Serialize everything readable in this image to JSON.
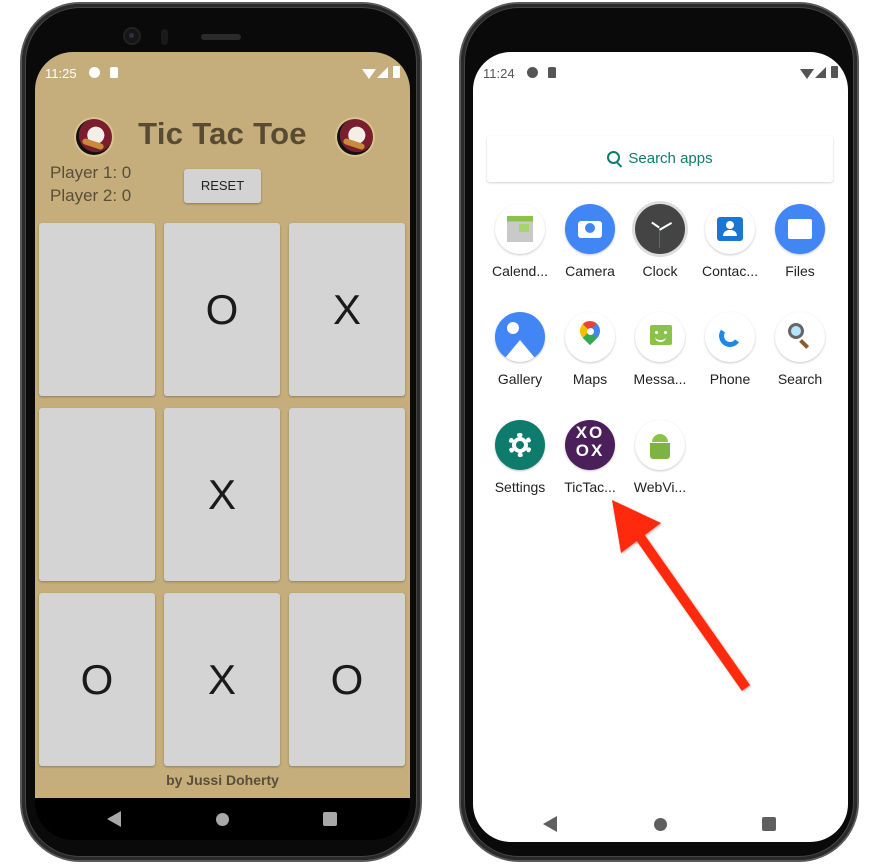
{
  "left_phone": {
    "status_bar": {
      "time": "11:25"
    },
    "app": {
      "title": "Tic Tac Toe",
      "scores": {
        "player1": "Player 1: 0",
        "player2": "Player 2: 0"
      },
      "reset_label": "RESET",
      "board": [
        "",
        "O",
        "X",
        "",
        "X",
        "",
        "O",
        "X",
        "O"
      ],
      "credit": "by Jussi Doherty",
      "colors": {
        "background": "#c5ae7c",
        "cell": "#d3d4d3",
        "title": "#584a33"
      }
    },
    "nav": {
      "back": "back-icon",
      "home": "home-icon",
      "recents": "recents-icon"
    }
  },
  "right_phone": {
    "status_bar": {
      "time": "11:24"
    },
    "launcher": {
      "search_label": "Search apps",
      "apps": [
        {
          "label": "Calend...",
          "icon": "calendar-icon"
        },
        {
          "label": "Camera",
          "icon": "camera-icon"
        },
        {
          "label": "Clock",
          "icon": "clock-icon"
        },
        {
          "label": "Contac...",
          "icon": "contacts-icon"
        },
        {
          "label": "Files",
          "icon": "files-icon"
        },
        {
          "label": "Gallery",
          "icon": "gallery-icon"
        },
        {
          "label": "Maps",
          "icon": "maps-icon"
        },
        {
          "label": "Messa...",
          "icon": "messages-icon"
        },
        {
          "label": "Phone",
          "icon": "phone-icon"
        },
        {
          "label": "Search",
          "icon": "search-icon"
        },
        {
          "label": "Settings",
          "icon": "settings-icon"
        },
        {
          "label": "TicTac...",
          "icon": "tictactoe-icon"
        },
        {
          "label": "WebVi...",
          "icon": "webview-icon"
        }
      ],
      "accent": "#0f7b6c"
    },
    "annotation": {
      "type": "arrow",
      "color": "#ff2a0a",
      "points_to": "TicTac..."
    }
  }
}
